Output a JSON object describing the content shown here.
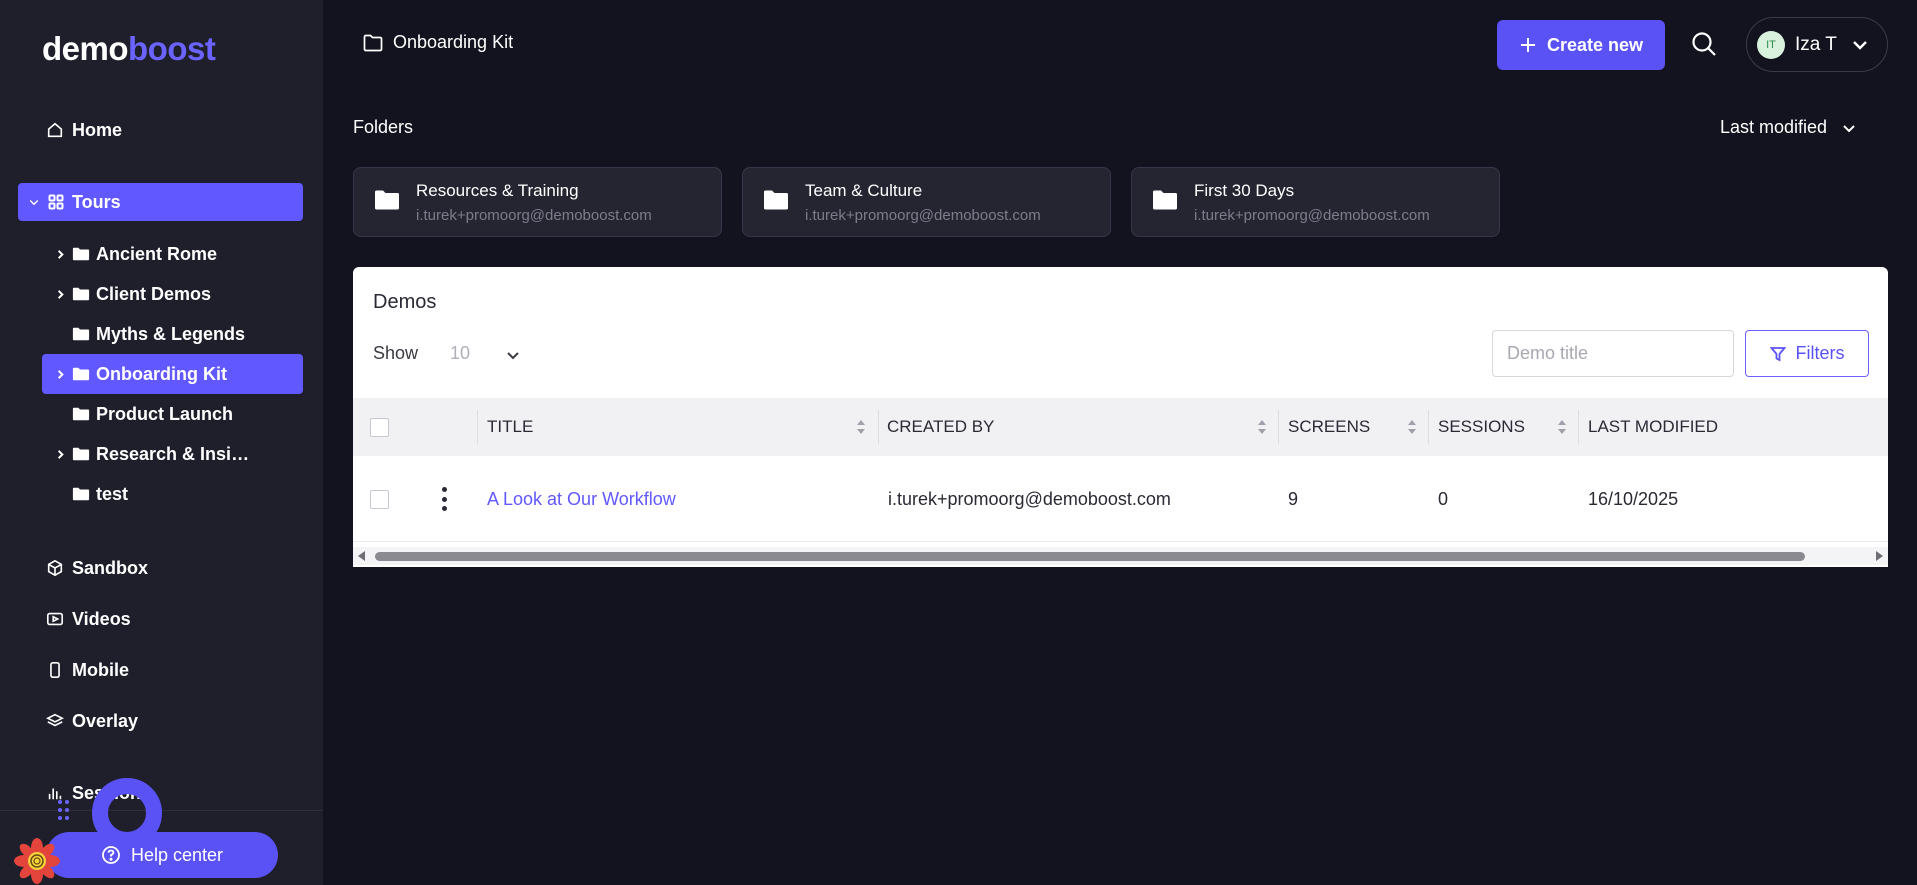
{
  "sidebar": {
    "logo_part1": "demo",
    "logo_part2": "boost",
    "home": "Home",
    "tours": "Tours",
    "folders": [
      {
        "label": "Ancient Rome",
        "expandable": true
      },
      {
        "label": "Client Demos",
        "expandable": true
      },
      {
        "label": "Myths & Legends",
        "expandable": false
      },
      {
        "label": "Onboarding Kit",
        "expandable": true,
        "active": true
      },
      {
        "label": "Product Launch",
        "expandable": false
      },
      {
        "label": "Research & Insights",
        "expandable": true
      },
      {
        "label": "test",
        "expandable": false
      }
    ],
    "sandbox": "Sandbox",
    "videos": "Videos",
    "mobile": "Mobile",
    "overlay": "Overlay",
    "sessions": "Sessions",
    "help": "Help center"
  },
  "header": {
    "breadcrumb": "Onboarding Kit",
    "create_label": "Create new",
    "user_initials": "IT",
    "user_name": "Iza T"
  },
  "folders_section": {
    "heading": "Folders",
    "sort_label": "Last modified",
    "cards": [
      {
        "name": "Resources & Training",
        "owner": "i.turek+promoorg@demoboost.com"
      },
      {
        "name": "Team & Culture",
        "owner": "i.turek+promoorg@demoboost.com"
      },
      {
        "name": "First 30 Days",
        "owner": "i.turek+promoorg@demoboost.com"
      }
    ]
  },
  "demos": {
    "title": "Demos",
    "show_label": "Show",
    "show_value": "10",
    "search_placeholder": "Demo title",
    "filters_label": "Filters",
    "columns": [
      "TITLE",
      "CREATED BY",
      "SCREENS",
      "SESSIONS",
      "LAST MODIFIED"
    ],
    "rows": [
      {
        "title": "A Look at Our Workflow",
        "created_by": "i.turek+promoorg@demoboost.com",
        "screens": "9",
        "sessions": "0",
        "last_modified": "16/10/2025"
      }
    ]
  },
  "colors": {
    "accent": "#5b52f5",
    "sidebar_bg": "#1f1f2c",
    "page_bg": "#13131f"
  }
}
